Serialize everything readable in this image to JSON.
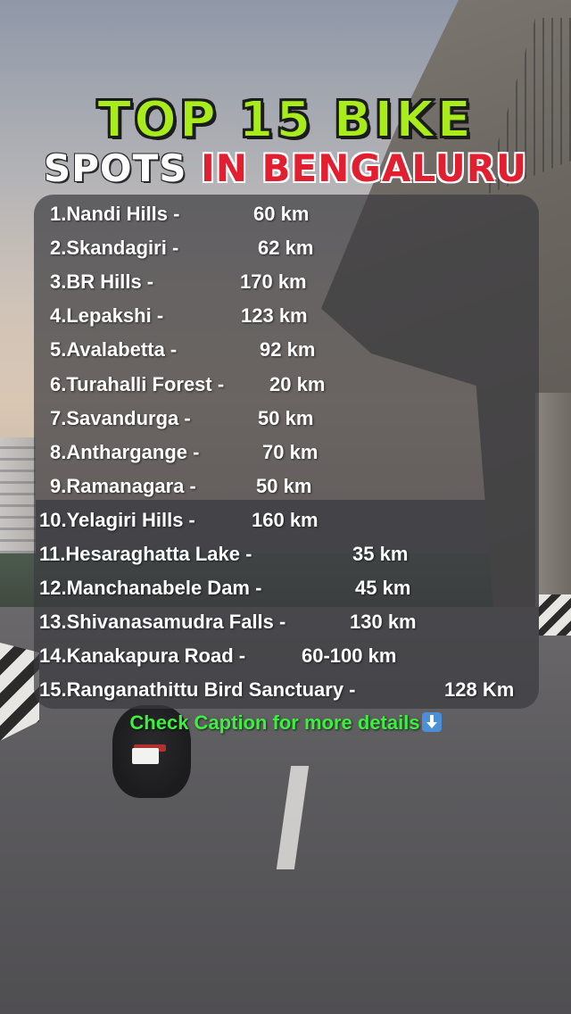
{
  "title": {
    "line1": "TOP 15 BIKE",
    "line2_a": "SPOTS",
    "line2_b": "IN BENGALURU"
  },
  "spots": [
    {
      "name": "1.Nandi Hills -",
      "distance": "60 km"
    },
    {
      "name": "2.Skandagiri -",
      "distance": "62 km"
    },
    {
      "name": "3.BR Hills -",
      "distance": "170 km"
    },
    {
      "name": "4.Lepakshi -",
      "distance": "123 km"
    },
    {
      "name": "5.Avalabetta -",
      "distance": "92 km"
    },
    {
      "name": "6.Turahalli Forest -",
      "distance": "20 km"
    },
    {
      "name": "7.Savandurga -",
      "distance": "50 km"
    },
    {
      "name": "8.Anthargange -",
      "distance": "70 km"
    },
    {
      "name": "9.Ramanagara -",
      "distance": "50 km"
    },
    {
      "name": "10.Yelagiri Hills -",
      "distance": "160 km"
    },
    {
      "name": "11.Hesaraghatta Lake -",
      "distance": "35 km"
    },
    {
      "name": "12.Manchanabele Dam -",
      "distance": "45 km"
    },
    {
      "name": "13.Shivanasamudra Falls -",
      "distance": "130 km"
    },
    {
      "name": "14.Kanakapura Road -",
      "distance": "60-100 km"
    },
    {
      "name": "15.Ranganathittu Bird Sanctuary -",
      "distance": "128 Km"
    }
  ],
  "footer": {
    "text": "Check Caption for more details",
    "icon": "down-arrow-icon"
  },
  "colors": {
    "title_green": "#a8ec1c",
    "title_red": "#e11f30",
    "footer_green": "#3cf040"
  }
}
